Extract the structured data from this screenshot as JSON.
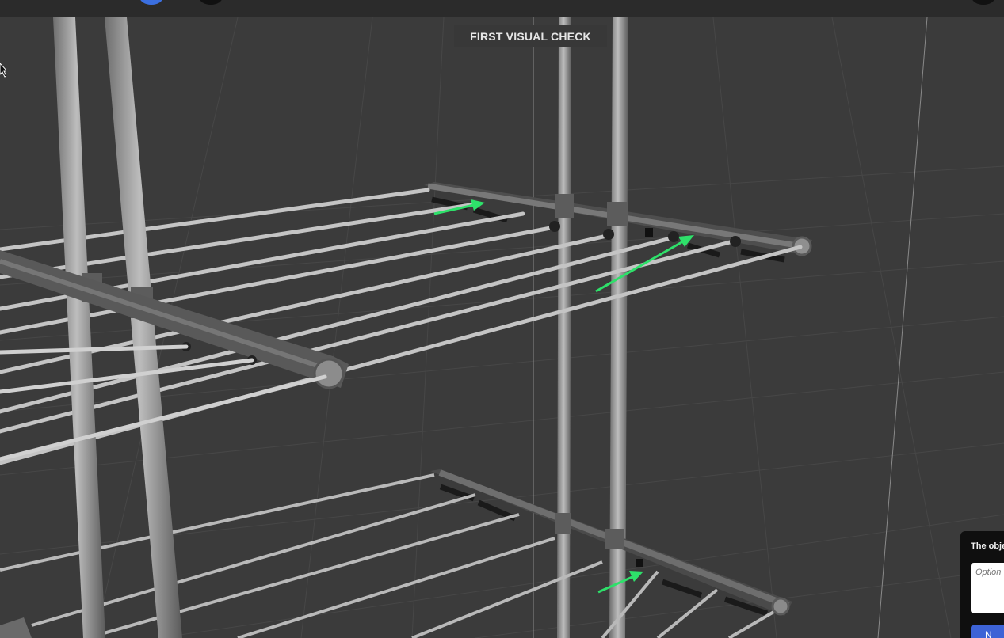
{
  "header": {
    "check_title": "FIRST VISUAL CHECK"
  },
  "feedback": {
    "question_label": "The obje",
    "input_placeholder": "Option",
    "next_label": "N"
  },
  "colors": {
    "topbar": "#2b2b2b",
    "viewport_bg": "#3b3b3b",
    "arrow": "#2ee06a",
    "accent_blue": "#3d63d6"
  },
  "icons": [
    "cursor-icon"
  ]
}
